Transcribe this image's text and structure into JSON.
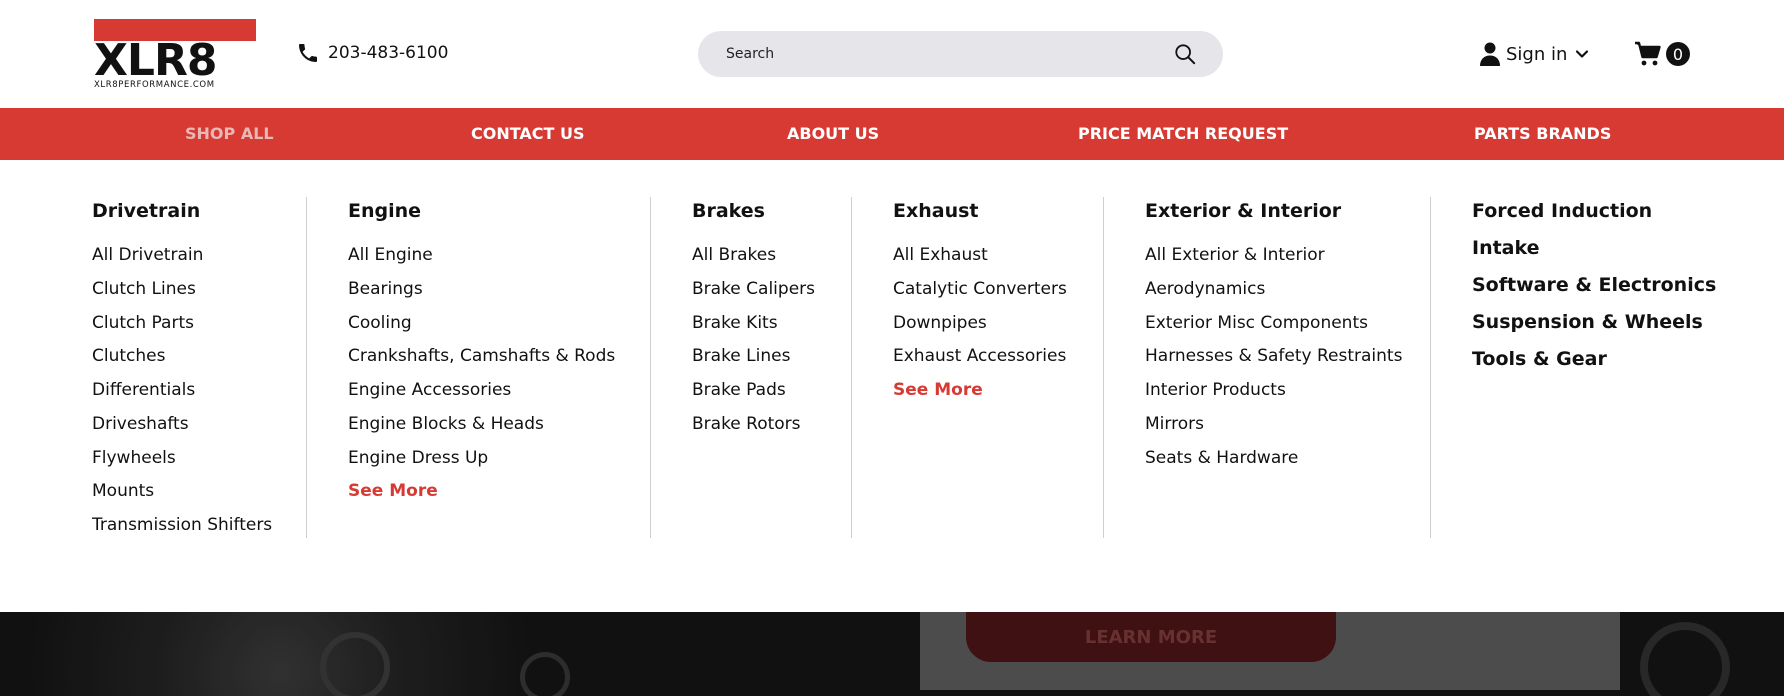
{
  "header": {
    "logo_text": "XLR8",
    "logo_domain": "XLR8PERFORMANCE.COM",
    "phone": "203-483-6100",
    "search_placeholder": "Search",
    "signin_label": "Sign in",
    "cart_count": "0"
  },
  "nav": {
    "items": [
      {
        "label": "SHOP ALL"
      },
      {
        "label": "CONTACT US"
      },
      {
        "label": "ABOUT US"
      },
      {
        "label": "PRICE MATCH REQUEST"
      },
      {
        "label": "PARTS BRANDS"
      }
    ]
  },
  "menu": {
    "columns": [
      {
        "title": "Drivetrain",
        "links": [
          "All Drivetrain",
          "Clutch Lines",
          "Clutch Parts",
          "Clutches",
          "Differentials",
          "Driveshafts",
          "Flywheels",
          "Mounts",
          "Transmission Shifters"
        ]
      },
      {
        "title": "Engine",
        "links": [
          "All Engine",
          "Bearings",
          "Cooling",
          "Crankshafts, Camshafts & Rods",
          "Engine Accessories",
          "Engine Blocks & Heads",
          "Engine Dress Up"
        ],
        "more": "See More"
      },
      {
        "title": "Brakes",
        "links": [
          "All Brakes",
          "Brake Calipers",
          "Brake Kits",
          "Brake Lines",
          "Brake Pads",
          "Brake Rotors"
        ]
      },
      {
        "title": "Exhaust",
        "links": [
          "All Exhaust",
          "Catalytic Converters",
          "Downpipes",
          "Exhaust Accessories"
        ],
        "more": "See More"
      },
      {
        "title": "Exterior & Interior",
        "links": [
          "All Exterior & Interior",
          "Aerodynamics",
          "Exterior Misc Components",
          "Harnesses & Safety Restraints",
          "Interior Products",
          "Mirrors",
          "Seats & Hardware"
        ]
      }
    ],
    "categories": [
      "Forced Induction",
      "Intake",
      "Software & Electronics",
      "Suspension & Wheels",
      "Tools & Gear"
    ]
  },
  "hero": {
    "button_label": "LEARN MORE"
  },
  "colors": {
    "accent": "#d63a33",
    "text": "#111111",
    "search_bg": "#e6e6ea"
  }
}
